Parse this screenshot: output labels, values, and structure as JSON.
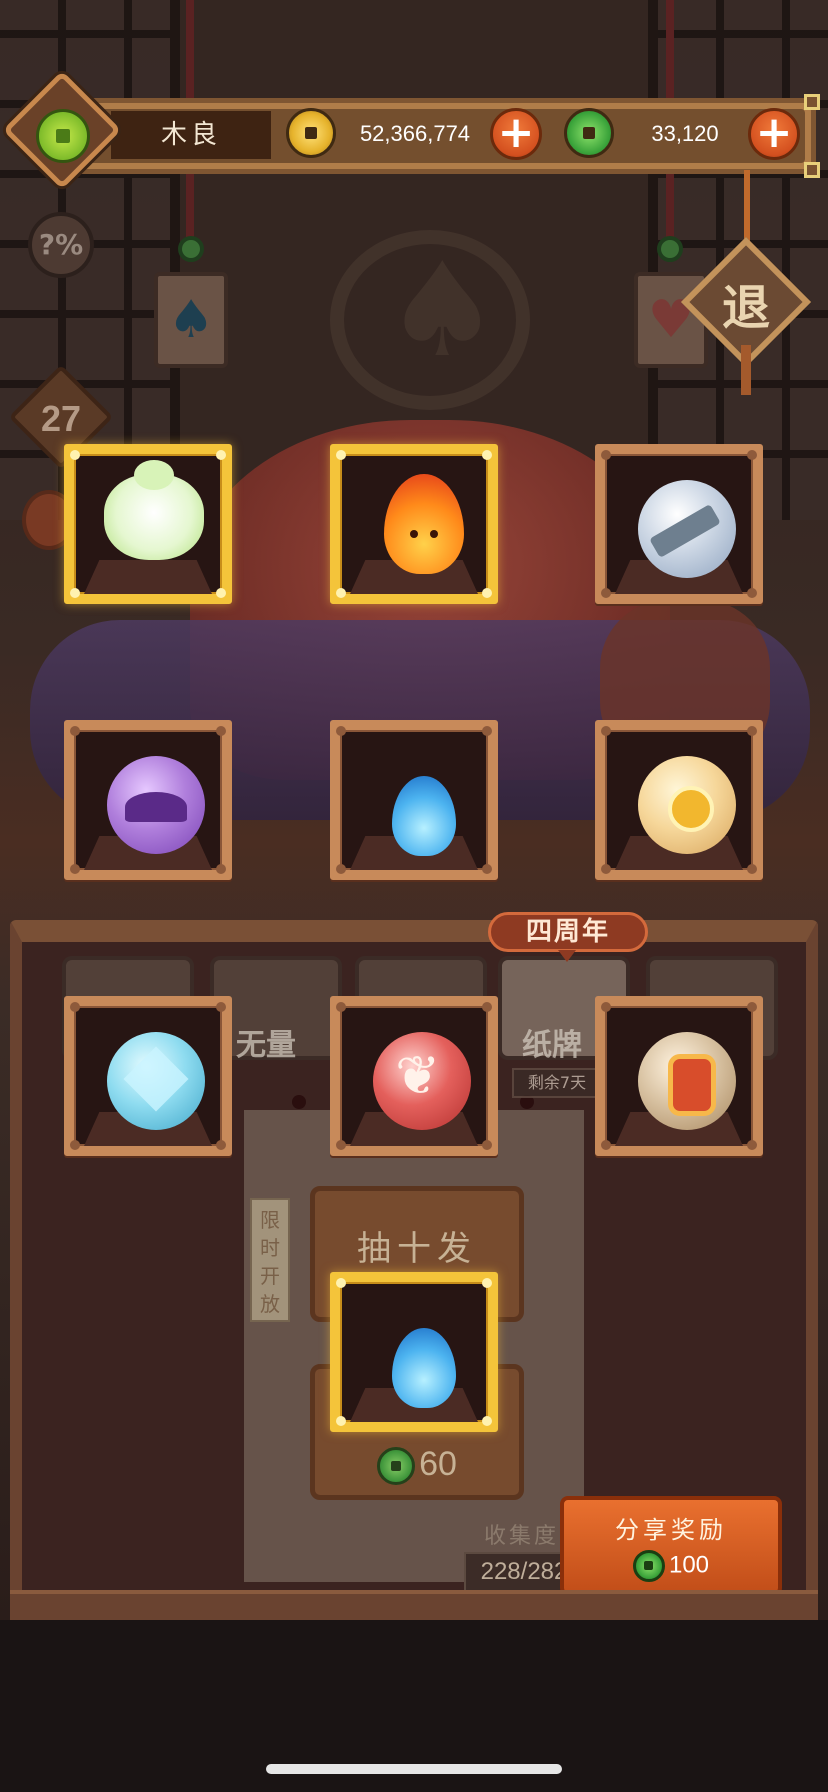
{
  "player": {
    "name": "木良"
  },
  "currency": {
    "gold": {
      "amount": "52,366,774",
      "icon": "gold-coin-icon"
    },
    "jade": {
      "amount": "33,120",
      "icon": "jade-coin-icon"
    },
    "add_label": "+"
  },
  "side": {
    "odds_label": "?%",
    "level": "27"
  },
  "exit": {
    "label": "退"
  },
  "rewards": [
    {
      "icon": "white-spirit-icon",
      "highlighted": true
    },
    {
      "icon": "fire-spirit-icon",
      "highlighted": true
    },
    {
      "icon": "blade-orb-icon",
      "highlighted": false
    },
    {
      "icon": "purple-mushroom-orb-icon",
      "highlighted": false
    },
    {
      "icon": "blue-flame-icon",
      "highlighted": false
    },
    {
      "icon": "sun-orb-icon",
      "highlighted": false
    },
    {
      "icon": "crystal-orb-icon",
      "highlighted": false
    },
    {
      "icon": "wing-orb-icon",
      "highlighted": false
    },
    {
      "icon": "rune-orb-icon",
      "highlighted": false
    },
    {
      "icon": "blue-flame-icon",
      "highlighted": true
    }
  ],
  "panel": {
    "anniversary_banner": "四周年",
    "tabs": [
      "无量",
      "纸牌"
    ],
    "days_left": "剩余7天",
    "limited_tag": "限时开放",
    "draw_ten_label": "抽十发",
    "draw_one_cost": "60",
    "collection_label": "收集度",
    "collection_value": "228/282"
  },
  "share": {
    "label": "分享奖励",
    "reward": "100"
  },
  "colors": {
    "accent": "#d4501f",
    "frame_gold": "#f4c43a",
    "frame_wood": "#c88a5a"
  }
}
